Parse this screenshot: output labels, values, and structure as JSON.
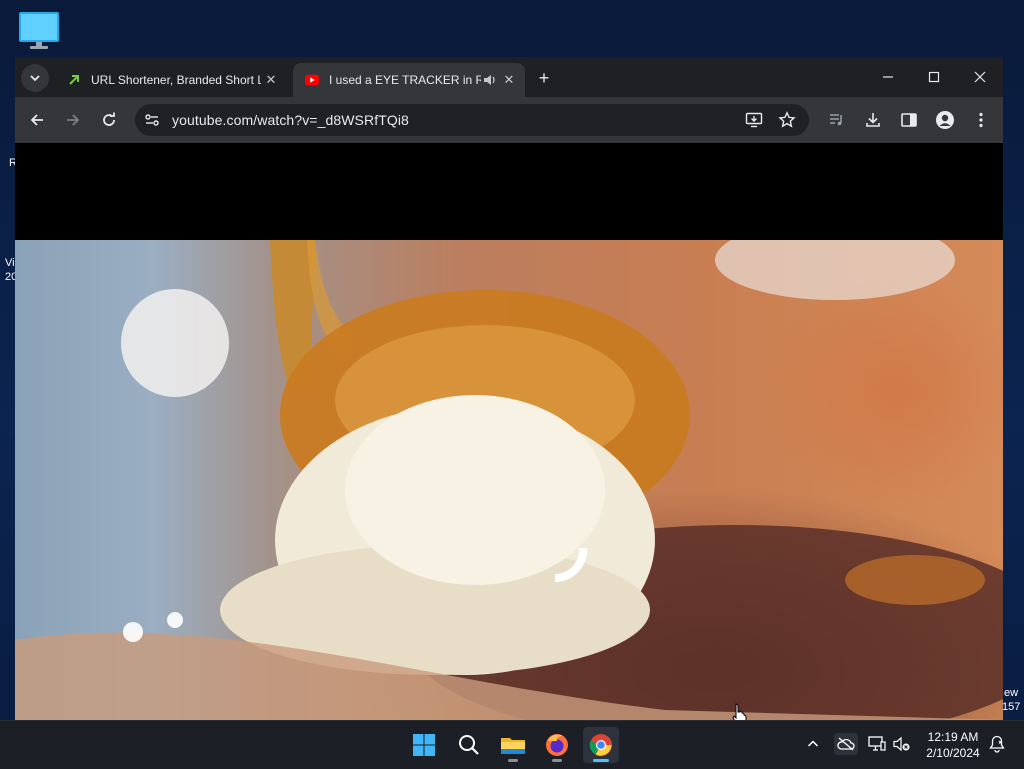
{
  "desktop": {
    "fragments": [
      "R",
      "Vi",
      "20",
      "ew",
      "157"
    ]
  },
  "browser": {
    "tabs": [
      {
        "title": "URL Shortener, Branded Short L",
        "active": false,
        "favicon": "bitly-icon"
      },
      {
        "title": "I used a EYE TRACKER in Ro",
        "active": true,
        "favicon": "youtube-icon",
        "audio": true
      }
    ],
    "address": {
      "url": "youtube.com/watch?v=_d8WSRfTQi8"
    }
  },
  "taskbar": {
    "apps": [
      "windows-start-icon",
      "search-icon",
      "file-explorer-icon",
      "firefox-icon",
      "chrome-icon"
    ],
    "clock": {
      "time": "12:19 AM",
      "date": "2/10/2024"
    }
  },
  "colors": {
    "tabstrip": "#1f2023",
    "toolbar": "#35363a",
    "omnibox": "#202124",
    "taskbar": "#1c1f26",
    "youtube_red": "#ff0000",
    "accent_blue": "#4cc2ff"
  }
}
